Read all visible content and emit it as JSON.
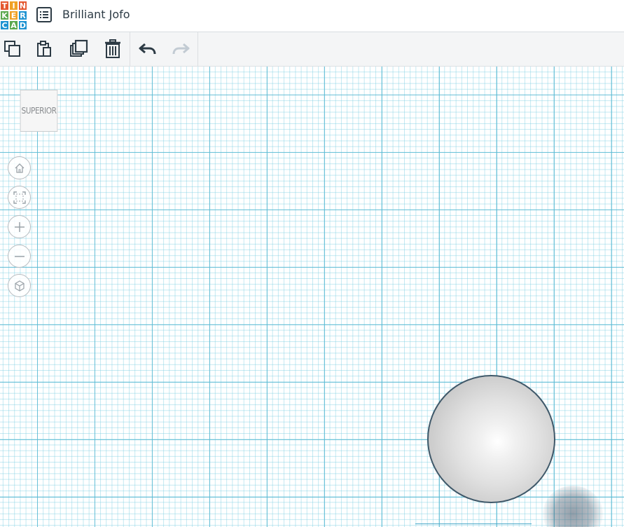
{
  "app": {
    "logo_letters": [
      "T",
      "I",
      "N",
      "K",
      "E",
      "R",
      "C",
      "A",
      "D"
    ],
    "logo_colors": [
      "#e4572e",
      "#f0a125",
      "#e4572e",
      "#5aa84f",
      "#f0a125",
      "#1f93d1",
      "#1f93d1",
      "#5aa84f",
      "#1f93d1"
    ],
    "design_title": "Brilliant Jofo"
  },
  "toolbar": {
    "tools": [
      {
        "name": "copy",
        "icon": "copy-icon"
      },
      {
        "name": "paste",
        "icon": "paste-icon"
      },
      {
        "name": "duplicate",
        "icon": "duplicate-icon"
      },
      {
        "name": "delete",
        "icon": "trash-icon"
      },
      {
        "name": "undo",
        "icon": "undo-icon"
      },
      {
        "name": "redo",
        "icon": "redo-icon",
        "disabled": true
      }
    ]
  },
  "viewport": {
    "view_cube_label": "SUPERIOR",
    "nav_controls": [
      "home-icon",
      "fit-view-icon",
      "zoom-in-icon",
      "zoom-out-icon",
      "ortho-view-icon"
    ],
    "grid_color": "#5cbad3",
    "shape": {
      "type": "sphere",
      "outline_color": "#3f5869"
    }
  }
}
